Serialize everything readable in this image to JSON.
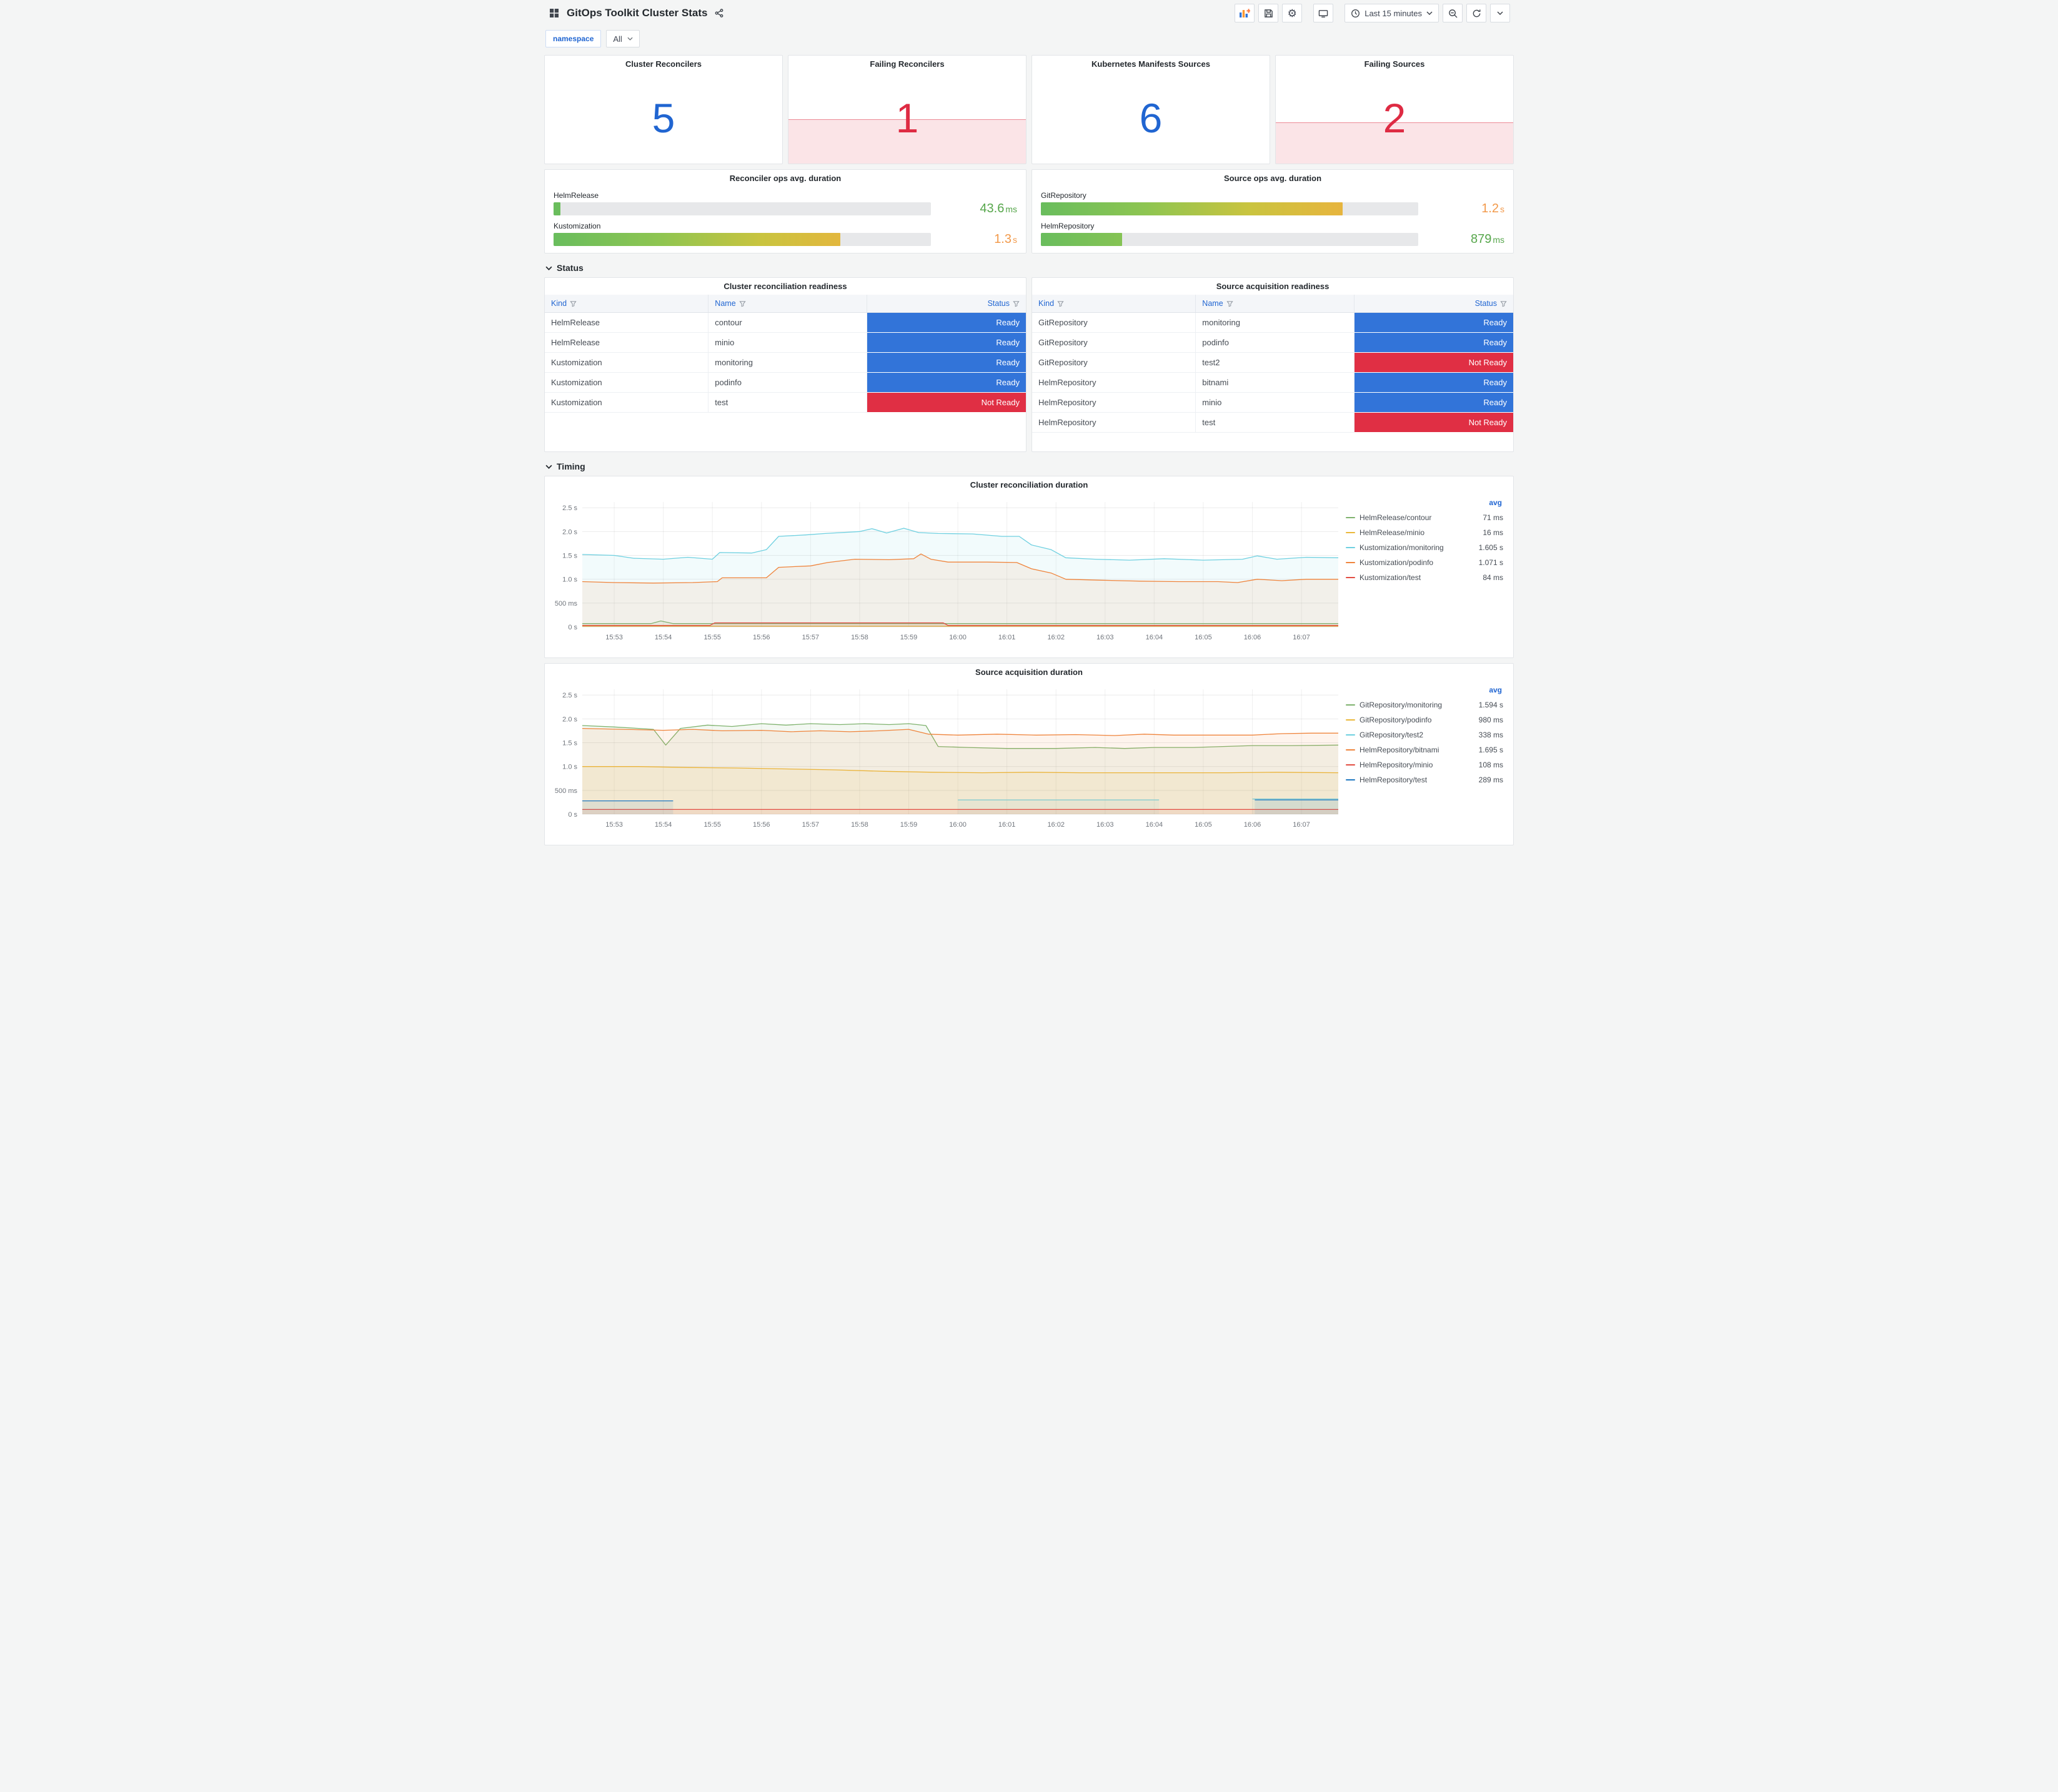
{
  "header": {
    "title": "GitOps Toolkit Cluster Stats"
  },
  "toolbar": {
    "time_range_label": "Last 15 minutes"
  },
  "variables": {
    "label": "namespace",
    "value": "All"
  },
  "sections": {
    "status": "Status",
    "timing": "Timing"
  },
  "stats": [
    {
      "title": "Cluster Reconcilers",
      "value": "5",
      "color": "#2065D1"
    },
    {
      "title": "Failing Reconcilers",
      "value": "1",
      "color": "#DE2B43",
      "spark_pct": 41
    },
    {
      "title": "Kubernetes Manifests Sources",
      "value": "6",
      "color": "#2065D1"
    },
    {
      "title": "Failing Sources",
      "value": "2",
      "color": "#DE2B43",
      "spark_pct": 38
    }
  ],
  "gauges": [
    {
      "title": "Reconciler ops avg. duration",
      "bars": [
        {
          "label": "HelmRelease",
          "pct": 1.8,
          "value": "43.6",
          "unit": "ms",
          "value_color": "#56A64B"
        },
        {
          "label": "Kustomization",
          "pct": 76,
          "value": "1.3",
          "unit": "s",
          "value_color": "#F2994A"
        }
      ]
    },
    {
      "title": "Source ops avg. duration",
      "bars": [
        {
          "label": "GitRepository",
          "pct": 80,
          "value": "1.2",
          "unit": "s",
          "value_color": "#F2994A"
        },
        {
          "label": "HelmRepository",
          "pct": 21.5,
          "value": "879",
          "unit": "ms",
          "value_color": "#56A64B"
        }
      ]
    }
  ],
  "status_colors": {
    "Ready": "#3274D9",
    "Not Ready": "#E02F44"
  },
  "tables": [
    {
      "title": "Cluster reconciliation readiness",
      "columns": [
        "Kind",
        "Name",
        "Status"
      ],
      "rows": [
        {
          "kind": "HelmRelease",
          "name": "contour",
          "status": "Ready"
        },
        {
          "kind": "HelmRelease",
          "name": "minio",
          "status": "Ready"
        },
        {
          "kind": "Kustomization",
          "name": "monitoring",
          "status": "Ready"
        },
        {
          "kind": "Kustomization",
          "name": "podinfo",
          "status": "Ready"
        },
        {
          "kind": "Kustomization",
          "name": "test",
          "status": "Not Ready"
        }
      ]
    },
    {
      "title": "Source acquisition readiness",
      "columns": [
        "Kind",
        "Name",
        "Status"
      ],
      "rows": [
        {
          "kind": "GitRepository",
          "name": "monitoring",
          "status": "Ready"
        },
        {
          "kind": "GitRepository",
          "name": "podinfo",
          "status": "Ready"
        },
        {
          "kind": "GitRepository",
          "name": "test2",
          "status": "Not Ready"
        },
        {
          "kind": "HelmRepository",
          "name": "bitnami",
          "status": "Ready"
        },
        {
          "kind": "HelmRepository",
          "name": "minio",
          "status": "Ready"
        },
        {
          "kind": "HelmRepository",
          "name": "test",
          "status": "Not Ready"
        }
      ]
    }
  ],
  "chart_data": [
    {
      "type": "line",
      "title": "Cluster reconciliation duration",
      "legend_header": "avg",
      "x_range": [
        52.35,
        67.75
      ],
      "ylim": [
        0,
        2.62
      ],
      "x_ticks": [
        {
          "t": 53,
          "label": "15:53"
        },
        {
          "t": 54,
          "label": "15:54"
        },
        {
          "t": 55,
          "label": "15:55"
        },
        {
          "t": 56,
          "label": "15:56"
        },
        {
          "t": 57,
          "label": "15:57"
        },
        {
          "t": 58,
          "label": "15:58"
        },
        {
          "t": 59,
          "label": "15:59"
        },
        {
          "t": 60,
          "label": "16:00"
        },
        {
          "t": 61,
          "label": "16:01"
        },
        {
          "t": 62,
          "label": "16:02"
        },
        {
          "t": 63,
          "label": "16:03"
        },
        {
          "t": 64,
          "label": "16:04"
        },
        {
          "t": 65,
          "label": "16:05"
        },
        {
          "t": 66,
          "label": "16:06"
        },
        {
          "t": 67,
          "label": "16:07"
        }
      ],
      "y_ticks": [
        {
          "v": 0,
          "label": "0 s"
        },
        {
          "v": 0.5,
          "label": "500 ms"
        },
        {
          "v": 1,
          "label": "1.0 s"
        },
        {
          "v": 1.5,
          "label": "1.5 s"
        },
        {
          "v": 2,
          "label": "2.0 s"
        },
        {
          "v": 2.5,
          "label": "2.5 s"
        }
      ],
      "series": [
        {
          "name": "HelmRelease/contour",
          "color": "#7EB26D",
          "avg": "71 ms",
          "points": [
            [
              52.35,
              0.07
            ],
            [
              53.75,
              0.07
            ],
            [
              53.95,
              0.125
            ],
            [
              54.2,
              0.07
            ],
            [
              60,
              0.07
            ],
            [
              67.75,
              0.07
            ]
          ]
        },
        {
          "name": "HelmRelease/minio",
          "color": "#EAB839",
          "avg": "16 ms",
          "points": [
            [
              52.35,
              0.016
            ],
            [
              67.75,
              0.016
            ]
          ]
        },
        {
          "name": "Kustomization/monitoring",
          "color": "#6ED0E0",
          "avg": "1.605 s",
          "points": [
            [
              52.35,
              1.52
            ],
            [
              53,
              1.5
            ],
            [
              53.4,
              1.44
            ],
            [
              54,
              1.42
            ],
            [
              54.5,
              1.46
            ],
            [
              55,
              1.42
            ],
            [
              55.15,
              1.56
            ],
            [
              55.8,
              1.55
            ],
            [
              56.1,
              1.62
            ],
            [
              56.35,
              1.9
            ],
            [
              56.9,
              1.93
            ],
            [
              57.3,
              1.96
            ],
            [
              58,
              2.0
            ],
            [
              58.25,
              2.06
            ],
            [
              58.55,
              1.97
            ],
            [
              58.9,
              2.07
            ],
            [
              59.2,
              1.98
            ],
            [
              59.6,
              1.96
            ],
            [
              60.3,
              1.95
            ],
            [
              60.9,
              1.9
            ],
            [
              61.25,
              1.9
            ],
            [
              61.5,
              1.72
            ],
            [
              61.9,
              1.62
            ],
            [
              62.2,
              1.45
            ],
            [
              62.8,
              1.42
            ],
            [
              63.5,
              1.4
            ],
            [
              64.2,
              1.43
            ],
            [
              65,
              1.4
            ],
            [
              65.8,
              1.42
            ],
            [
              66.1,
              1.49
            ],
            [
              66.5,
              1.42
            ],
            [
              67.1,
              1.46
            ],
            [
              67.75,
              1.45
            ]
          ]
        },
        {
          "name": "Kustomization/podinfo",
          "color": "#EF843C",
          "avg": "1.071 s",
          "points": [
            [
              52.35,
              0.95
            ],
            [
              53,
              0.93
            ],
            [
              53.8,
              0.92
            ],
            [
              54.6,
              0.93
            ],
            [
              55.1,
              0.95
            ],
            [
              55.2,
              1.03
            ],
            [
              56.1,
              1.03
            ],
            [
              56.35,
              1.25
            ],
            [
              57,
              1.28
            ],
            [
              57.35,
              1.35
            ],
            [
              57.9,
              1.42
            ],
            [
              58.6,
              1.41
            ],
            [
              59.1,
              1.43
            ],
            [
              59.25,
              1.53
            ],
            [
              59.45,
              1.42
            ],
            [
              59.8,
              1.36
            ],
            [
              60.6,
              1.36
            ],
            [
              61.2,
              1.35
            ],
            [
              61.5,
              1.22
            ],
            [
              61.9,
              1.13
            ],
            [
              62.2,
              1.0
            ],
            [
              62.9,
              0.98
            ],
            [
              63.7,
              0.96
            ],
            [
              64.5,
              0.95
            ],
            [
              65.3,
              0.95
            ],
            [
              65.7,
              0.93
            ],
            [
              66.1,
              1.0
            ],
            [
              66.6,
              0.97
            ],
            [
              67.1,
              1.0
            ],
            [
              67.75,
              1.0
            ]
          ]
        },
        {
          "name": "Kustomization/test",
          "color": "#E24D42",
          "avg": "84 ms",
          "points": [
            [
              52.35,
              0.03
            ],
            [
              54.95,
              0.03
            ],
            [
              55.05,
              0.085
            ],
            [
              59.7,
              0.085
            ],
            [
              59.8,
              0.03
            ],
            [
              67.75,
              0.03
            ]
          ]
        }
      ]
    },
    {
      "type": "line",
      "title": "Source acquisition duration",
      "legend_header": "avg",
      "x_range": [
        52.35,
        67.75
      ],
      "ylim": [
        0,
        2.62
      ],
      "x_ticks": [
        {
          "t": 53,
          "label": "15:53"
        },
        {
          "t": 54,
          "label": "15:54"
        },
        {
          "t": 55,
          "label": "15:55"
        },
        {
          "t": 56,
          "label": "15:56"
        },
        {
          "t": 57,
          "label": "15:57"
        },
        {
          "t": 58,
          "label": "15:58"
        },
        {
          "t": 59,
          "label": "15:59"
        },
        {
          "t": 60,
          "label": "16:00"
        },
        {
          "t": 61,
          "label": "16:01"
        },
        {
          "t": 62,
          "label": "16:02"
        },
        {
          "t": 63,
          "label": "16:03"
        },
        {
          "t": 64,
          "label": "16:04"
        },
        {
          "t": 65,
          "label": "16:05"
        },
        {
          "t": 66,
          "label": "16:06"
        },
        {
          "t": 67,
          "label": "16:07"
        }
      ],
      "y_ticks": [
        {
          "v": 0,
          "label": "0 s"
        },
        {
          "v": 0.5,
          "label": "500 ms"
        },
        {
          "v": 1,
          "label": "1.0 s"
        },
        {
          "v": 1.5,
          "label": "1.5 s"
        },
        {
          "v": 2,
          "label": "2.0 s"
        },
        {
          "v": 2.5,
          "label": "2.5 s"
        }
      ],
      "series": [
        {
          "name": "GitRepository/monitoring",
          "color": "#7EB26D",
          "avg": "1.594 s",
          "points": [
            [
              52.35,
              1.86
            ],
            [
              53,
              1.83
            ],
            [
              53.5,
              1.8
            ],
            [
              53.8,
              1.78
            ],
            [
              54.05,
              1.45
            ],
            [
              54.35,
              1.8
            ],
            [
              54.9,
              1.87
            ],
            [
              55.4,
              1.84
            ],
            [
              56,
              1.9
            ],
            [
              56.5,
              1.87
            ],
            [
              57,
              1.9
            ],
            [
              57.6,
              1.88
            ],
            [
              58.1,
              1.9
            ],
            [
              58.6,
              1.88
            ],
            [
              59,
              1.9
            ],
            [
              59.35,
              1.86
            ],
            [
              59.6,
              1.42
            ],
            [
              60.2,
              1.4
            ],
            [
              61,
              1.38
            ],
            [
              62,
              1.38
            ],
            [
              62.8,
              1.4
            ],
            [
              63.4,
              1.38
            ],
            [
              64,
              1.4
            ],
            [
              64.8,
              1.4
            ],
            [
              65.4,
              1.42
            ],
            [
              66,
              1.44
            ],
            [
              66.8,
              1.44
            ],
            [
              67.75,
              1.45
            ]
          ]
        },
        {
          "name": "GitRepository/podinfo",
          "color": "#EAB839",
          "avg": "980 ms",
          "points": [
            [
              52.35,
              1.0
            ],
            [
              53.5,
              1.0
            ],
            [
              54.5,
              0.98
            ],
            [
              55.5,
              0.97
            ],
            [
              56.5,
              0.95
            ],
            [
              57.5,
              0.93
            ],
            [
              58.5,
              0.9
            ],
            [
              59.5,
              0.88
            ],
            [
              60.5,
              0.87
            ],
            [
              61.5,
              0.88
            ],
            [
              62.5,
              0.87
            ],
            [
              63.5,
              0.87
            ],
            [
              64.5,
              0.87
            ],
            [
              65.5,
              0.87
            ],
            [
              66.5,
              0.88
            ],
            [
              67.75,
              0.87
            ]
          ]
        },
        {
          "name": "GitRepository/test2",
          "color": "#6ED0E0",
          "avg": "338 ms",
          "points": [
            [
              60,
              0.3
            ],
            [
              64.1,
              0.3
            ],
            [
              64.2,
              null
            ],
            [
              66,
              0.32
            ],
            [
              67.75,
              0.32
            ]
          ]
        },
        {
          "name": "HelmRepository/bitnami",
          "color": "#EF843C",
          "avg": "1.695 s",
          "points": [
            [
              52.35,
              1.8
            ],
            [
              53.2,
              1.78
            ],
            [
              54,
              1.76
            ],
            [
              54.6,
              1.78
            ],
            [
              55.2,
              1.75
            ],
            [
              56,
              1.76
            ],
            [
              56.6,
              1.73
            ],
            [
              57.2,
              1.75
            ],
            [
              57.8,
              1.73
            ],
            [
              58.4,
              1.75
            ],
            [
              59,
              1.78
            ],
            [
              59.4,
              1.68
            ],
            [
              60,
              1.66
            ],
            [
              60.8,
              1.68
            ],
            [
              61.6,
              1.66
            ],
            [
              62.4,
              1.67
            ],
            [
              63.2,
              1.65
            ],
            [
              63.8,
              1.68
            ],
            [
              64.4,
              1.66
            ],
            [
              65.2,
              1.66
            ],
            [
              66,
              1.66
            ],
            [
              66.6,
              1.69
            ],
            [
              67.2,
              1.7
            ],
            [
              67.75,
              1.7
            ]
          ]
        },
        {
          "name": "HelmRepository/minio",
          "color": "#E24D42",
          "avg": "108 ms",
          "points": [
            [
              52.35,
              0.1
            ],
            [
              67.75,
              0.1
            ]
          ]
        },
        {
          "name": "HelmRepository/test",
          "color": "#1F78C1",
          "avg": "289 ms",
          "points": [
            [
              52.35,
              0.28
            ],
            [
              54.2,
              0.28
            ],
            [
              54.3,
              null
            ],
            [
              66.05,
              0.3
            ],
            [
              67.75,
              0.3
            ]
          ]
        }
      ]
    }
  ]
}
